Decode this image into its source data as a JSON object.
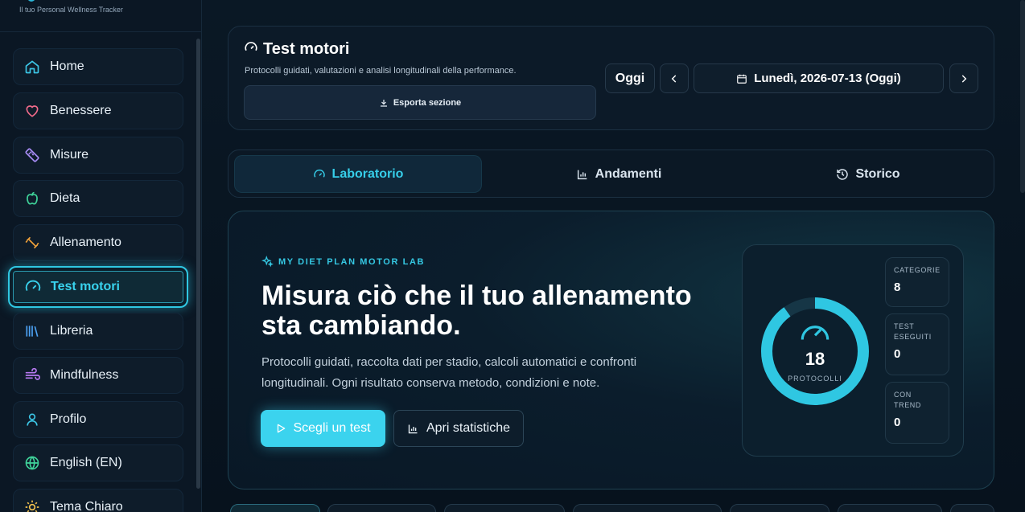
{
  "brand": {
    "tagline": "Il tuo Personal Wellness Tracker"
  },
  "sidebar": {
    "items": [
      {
        "label": "Home",
        "icon": "home-icon",
        "color": "#3cc6e6"
      },
      {
        "label": "Benessere",
        "icon": "heart-icon",
        "color": "#f06a8a"
      },
      {
        "label": "Misure",
        "icon": "ruler-icon",
        "color": "#a88cf5"
      },
      {
        "label": "Dieta",
        "icon": "apple-icon",
        "color": "#3fd39a"
      },
      {
        "label": "Allenamento",
        "icon": "dumbbell-icon",
        "color": "#f2a23a"
      },
      {
        "label": "Test motori",
        "icon": "gauge-icon",
        "color": "#39d3ee",
        "active": true
      },
      {
        "label": "Libreria",
        "icon": "library-icon",
        "color": "#4da3f5"
      },
      {
        "label": "Mindfulness",
        "icon": "wind-icon",
        "color": "#b87af2"
      },
      {
        "label": "Profilo",
        "icon": "user-icon",
        "color": "#3cc6e6"
      },
      {
        "label": "English (EN)",
        "icon": "globe-icon",
        "color": "#3fd39a"
      },
      {
        "label": "Tema Chiaro",
        "icon": "sun-icon",
        "color": "#f2c14e"
      }
    ]
  },
  "header": {
    "title": "Test motori",
    "subtitle": "Protocolli guidati, valutazioni e analisi longitudinali della performance.",
    "export_label": "Esporta sezione",
    "today_label": "Oggi",
    "date_label": "Lunedì, 2026-07-13 (Oggi)"
  },
  "tabs": [
    {
      "label": "Laboratorio",
      "active": true
    },
    {
      "label": "Andamenti"
    },
    {
      "label": "Storico"
    }
  ],
  "hero": {
    "kicker": "MY DIET PLAN MOTOR LAB",
    "title": "Misura ciò che il tuo allenamento sta cambiando.",
    "description": "Protocolli guidati, raccolta dati per stadio, calcoli automatici e confronti longitudinali. Ogni risultato conserva metodo, condizioni e note.",
    "primary_button": "Scegli un test",
    "secondary_button": "Apri statistiche"
  },
  "stats": {
    "protocols_count": "18",
    "protocols_label": "PROTOCOLLI",
    "items": [
      {
        "label": "CATEGORIE",
        "value": "8"
      },
      {
        "label": "TEST ESEGUITI",
        "value": "0"
      },
      {
        "label": "CON TREND",
        "value": "0"
      }
    ]
  },
  "colors": {
    "accent": "#39d3ee",
    "background": "#081521"
  }
}
